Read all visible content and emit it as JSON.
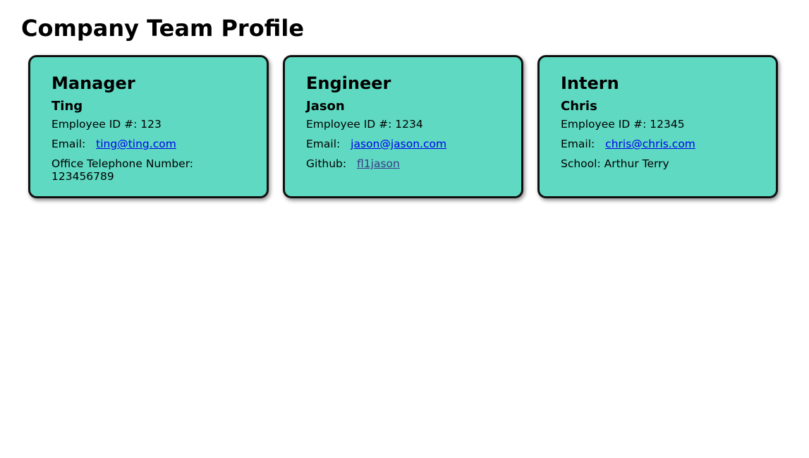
{
  "page": {
    "title": "Company Team Profile"
  },
  "cards": [
    {
      "role": "Manager",
      "name": "Ting",
      "id_label": "Employee ID #:",
      "id_value": "123",
      "email_label": "Email:",
      "email": "ting@ting.com",
      "extra_label": "Office Telephone Number:",
      "extra_value": "123456789"
    },
    {
      "role": "Engineer",
      "name": "Jason",
      "id_label": "Employee ID #:",
      "id_value": "1234",
      "email_label": "Email:",
      "email": "jason@jason.com",
      "extra_label": "Github:",
      "extra_value": "fl1jason"
    },
    {
      "role": "Intern",
      "name": "Chris",
      "id_label": "Employee ID #:",
      "id_value": "12345",
      "email_label": "Email:",
      "email": "chris@chris.com",
      "extra_label": "School:",
      "extra_value": "Arthur Terry"
    }
  ],
  "colors": {
    "card_background": "#5fd9c1",
    "card_border": "#111111",
    "link": "#0000ee"
  }
}
